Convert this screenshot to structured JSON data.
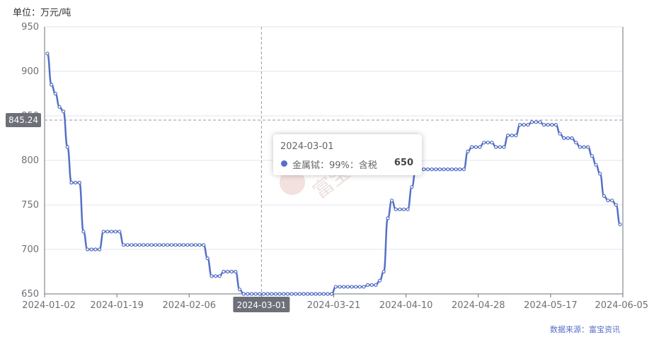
{
  "unit_label": "单位：万元/吨",
  "source_label": "数据来源：富宝资讯",
  "watermark": "富宝资讯",
  "colors": {
    "series": "#5470c6",
    "marker_bg": "#6e7079",
    "grid": "#e0e6f1",
    "axis": "#6e7079"
  },
  "crosshair": {
    "y_value": 845.24,
    "y_label": "845.24",
    "x_label": "2024-03-01"
  },
  "tooltip": {
    "date": "2024-03-01",
    "series": "金属铽：99%：含税",
    "value": "650"
  },
  "chart_data": {
    "type": "line",
    "title": "",
    "xlabel": "",
    "ylabel": "",
    "ylim": [
      650,
      950
    ],
    "yticks": [
      650,
      700,
      750,
      800,
      850,
      900,
      950
    ],
    "x_tick_labels": [
      "2024-01-02",
      "2024-01-19",
      "2024-02-06",
      "2024-03-01",
      "2024-03-21",
      "2024-04-10",
      "2024-04-28",
      "2024-05-17",
      "2024-06-05"
    ],
    "grid": true,
    "series": [
      {
        "name": "金属铽：99%：含税",
        "values": [
          920,
          885,
          875,
          860,
          855,
          815,
          775,
          775,
          775,
          720,
          700,
          700,
          700,
          700,
          720,
          720,
          720,
          720,
          720,
          705,
          705,
          705,
          705,
          705,
          705,
          705,
          705,
          705,
          705,
          705,
          705,
          705,
          705,
          705,
          705,
          705,
          705,
          705,
          705,
          705,
          690,
          670,
          670,
          670,
          675,
          675,
          675,
          675,
          655,
          650,
          650,
          650,
          650,
          650,
          650,
          650,
          650,
          650,
          650,
          650,
          650,
          650,
          650,
          650,
          650,
          650,
          650,
          650,
          650,
          650,
          650,
          650,
          658,
          658,
          658,
          658,
          658,
          658,
          658,
          658,
          660,
          660,
          660,
          665,
          675,
          735,
          755,
          745,
          745,
          745,
          745,
          770,
          790,
          790,
          790,
          790,
          790,
          790,
          790,
          790,
          790,
          790,
          790,
          790,
          790,
          810,
          815,
          815,
          815,
          820,
          820,
          820,
          815,
          815,
          815,
          828,
          828,
          828,
          840,
          840,
          840,
          843,
          843,
          843,
          840,
          840,
          840,
          840,
          830,
          825,
          825,
          825,
          820,
          815,
          815,
          815,
          805,
          795,
          785,
          760,
          755,
          755,
          750,
          728
        ]
      }
    ]
  }
}
